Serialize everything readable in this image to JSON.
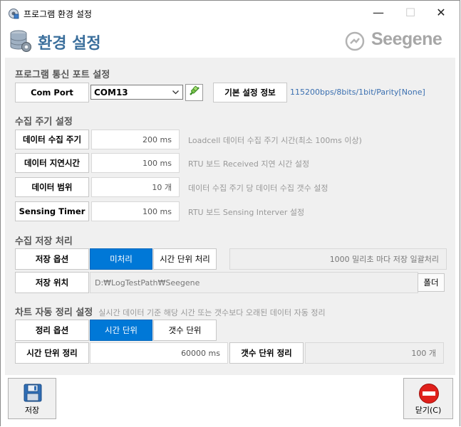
{
  "window": {
    "title": "프로그램 환경 설정",
    "minimize": "—",
    "maximize": "☐",
    "close": "✕"
  },
  "header": {
    "title": "환경 설정",
    "logo_text": "Seegene"
  },
  "port": {
    "section_title": "프로그램 통신 포트 설정",
    "com_port_label": "Com Port",
    "com_port_value": "COM13",
    "basic_info_label": "기본 설정 정보",
    "basic_info_value": "115200bps/8bits/1bit/Parity[None]"
  },
  "collection": {
    "section_title": "수집 주기 설정",
    "rows": [
      {
        "label": "데이터 수집 주기",
        "value": "200 ms",
        "note": "Loadcell 데이터 수집 주기 시간(최소 100ms 이상)"
      },
      {
        "label": "데이터 지연시간",
        "value": "100 ms",
        "note": "RTU 보드 Received 지연 시간 설정"
      },
      {
        "label": "데이터 범위",
        "value": "10 개",
        "note": "데이터 수집 주기 당 데이터 수집 갯수 설정"
      },
      {
        "label": "Sensing Timer",
        "value": "100 ms",
        "note": "RTU 보드 Sensing Interver 설정"
      }
    ]
  },
  "storage": {
    "section_title": "수집 저장 처리",
    "option_label": "저장 옵션",
    "option_a": "미처리",
    "option_b": "시간 단위 처리",
    "option_desc": "1000 밀리초 마다 저장 일괄처리",
    "location_label": "저장 위치",
    "location_value": "D:₩LogTestPath₩Seegene",
    "folder_button": "폴더"
  },
  "cleanup": {
    "section_title": "차트 자동 정리 설정",
    "section_note": "실시간 데이터 기준 해당 시간 또는 갯수보다 오래된 데이터 자동 정리",
    "option_label": "정리 옵션",
    "option_a": "시간 단위",
    "option_b": "갯수 단위",
    "time_label": "시간 단위 정리",
    "time_value": "60000 ms",
    "count_label": "갯수 단위 정리",
    "count_value": "100 개"
  },
  "footer": {
    "save_label": "저장",
    "close_label": "닫기(C)"
  },
  "colors": {
    "accent": "#0078d7",
    "title_blue": "#3b6f9c",
    "close_red": "#e0201b"
  }
}
